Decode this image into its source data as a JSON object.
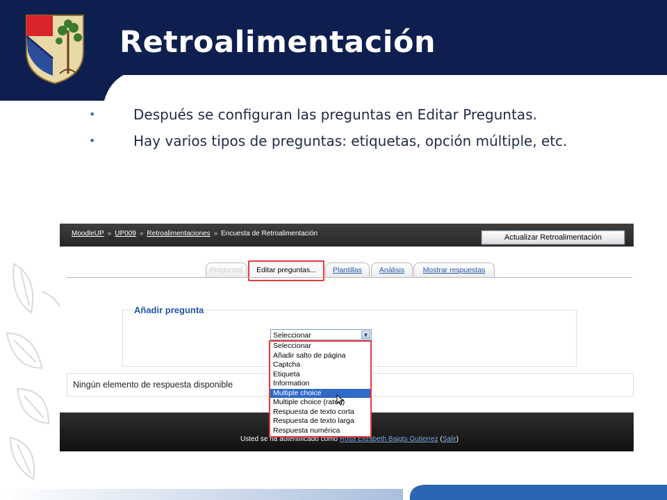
{
  "slide": {
    "title": "Retroalimentación",
    "bullets": [
      "Después se configuran las preguntas en Editar Preguntas.",
      "Hay varios tipos de preguntas: etiquetas, opción múltiple, etc."
    ],
    "colors": {
      "header": "#0e1f4f",
      "footer_blue": "#2a66b4",
      "bullet": "#2b6fb3"
    }
  },
  "screenshot": {
    "breadcrumb": [
      "MoodleUP",
      "UP009",
      "Retroalimentaciones",
      "Encuesta de Retroalimentación"
    ],
    "update_button": "Actualizar Retroalimentación",
    "tabs": {
      "hidden": "Preguntas",
      "edit": "Editar preguntas...",
      "templates": "Plantillas",
      "analysis": "Análisis",
      "responses": "Mostrar respuestas"
    },
    "add_question_legend": "Añadir pregunta",
    "select_value": "Seleccionar",
    "options": [
      "Seleccionar",
      "Añadir salto de página",
      "Captcha",
      "Etiqueta",
      "Information",
      "Multiple choice",
      "Multiple choice (rated)",
      "Respuesta de texto corta",
      "Respuesta de texto larga",
      "Respuesta numérica"
    ],
    "selected_option": "Multiple choice",
    "no_responses": "Ningún elemento de respuesta disponible",
    "login": {
      "prefix": "Usted se ha autentificado como",
      "user": "Rosa Elizabeth Baigts Gutierrez",
      "logout": "Salir"
    }
  }
}
